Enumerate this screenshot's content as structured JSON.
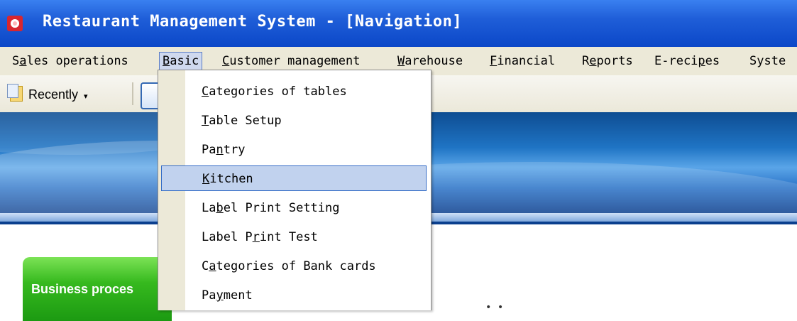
{
  "window": {
    "title": "Restaurant Management System - [Navigation]",
    "title_pre": "Restaurant ",
    "title_mn": "M",
    "title_mid": "anagement System - [",
    "title_mn2": "N",
    "title_post": "avigation]"
  },
  "menubar": {
    "items": [
      {
        "pre": "S",
        "mn": "a",
        "post": "les operations"
      },
      {
        "pre": "",
        "mn": "B",
        "post": "asic"
      },
      {
        "pre": "",
        "mn": "C",
        "post": "ustomer management"
      },
      {
        "pre": "",
        "mn": "W",
        "post": "arehouse"
      },
      {
        "pre": "",
        "mn": "F",
        "post": "inancial"
      },
      {
        "pre": "R",
        "mn": "e",
        "post": "ports"
      },
      {
        "pre": "E-reci",
        "mn": "p",
        "post": "es"
      },
      {
        "pre": "",
        "mn": "",
        "post": "Syste"
      }
    ],
    "active_index": 1
  },
  "toolbar": {
    "recently_label": "Recently",
    "recently_icon": "recent-documents-icon",
    "caret": "▾"
  },
  "dropdown": {
    "items": [
      {
        "pre": "",
        "mn": "C",
        "post": "ategories of tables"
      },
      {
        "pre": "",
        "mn": "T",
        "post": "able Setup"
      },
      {
        "pre": "Pa",
        "mn": "n",
        "post": "try"
      },
      {
        "pre": "",
        "mn": "K",
        "post": "itchen"
      },
      {
        "pre": "La",
        "mn": "b",
        "post": "el Print Setting"
      },
      {
        "pre": "Label P",
        "mn": "r",
        "post": "int Test"
      },
      {
        "pre": "C",
        "mn": "a",
        "post": "tegories of Bank cards"
      },
      {
        "pre": "Pa",
        "mn": "y",
        "post": "ment"
      }
    ],
    "active_index": 3
  },
  "business": {
    "label": "Business proces"
  },
  "colors": {
    "titlebar": "#0b47c8",
    "menu_highlight": "#c1d2ee",
    "business_green": "#36b91e"
  }
}
